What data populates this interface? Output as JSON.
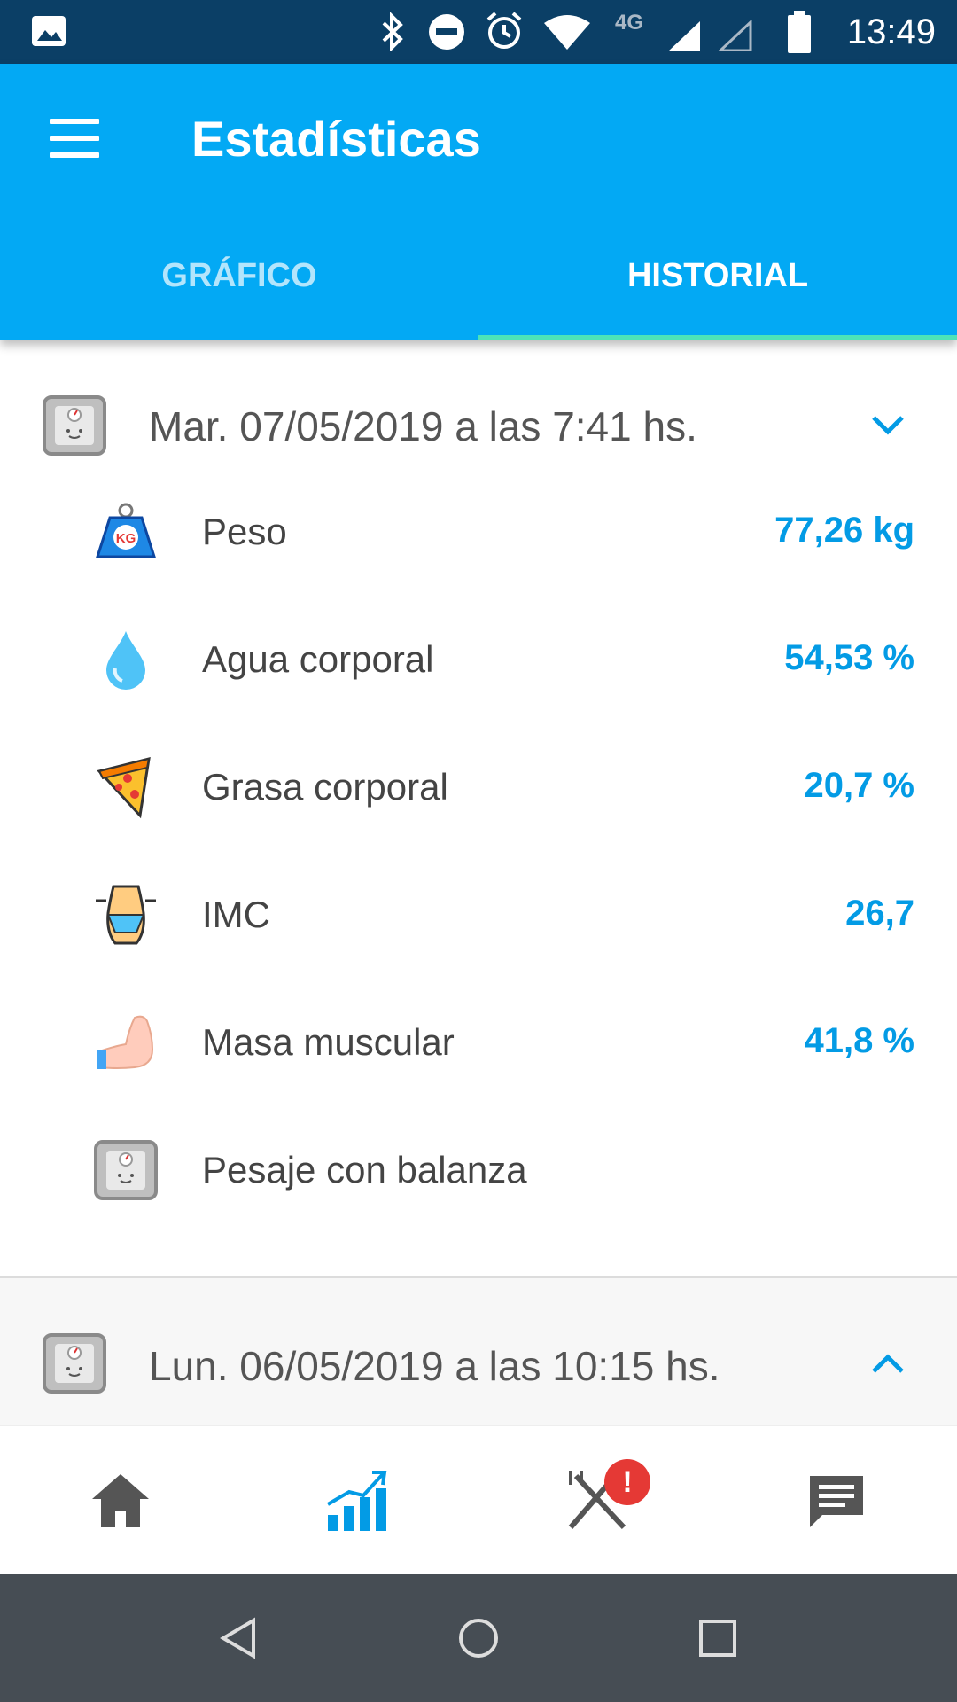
{
  "status_bar": {
    "time": "13:49",
    "network": "4G"
  },
  "header": {
    "title": "Estadísticas",
    "menu_icon": "hamburger-icon"
  },
  "tabs": [
    {
      "label": "GRÁFICO",
      "selected": false
    },
    {
      "label": "HISTORIAL",
      "selected": true
    }
  ],
  "entries": [
    {
      "date": "Mar. 07/05/2019 a las 7:41 hs.",
      "expanded": true,
      "rows": [
        {
          "label": "Peso",
          "value": "77,26 kg",
          "icon": "weight-kg-icon"
        },
        {
          "label": "Agua corporal",
          "value": "54,53 %",
          "icon": "water-drop-icon"
        },
        {
          "label": "Grasa corporal",
          "value": "20,7 %",
          "icon": "pizza-slice-icon"
        },
        {
          "label": "IMC",
          "value": "26,7",
          "icon": "waist-icon"
        },
        {
          "label": "Masa muscular",
          "value": "41,8 %",
          "icon": "flexed-arm-icon"
        },
        {
          "label": "Pesaje con balanza",
          "value": "",
          "icon": "scale-icon"
        }
      ]
    },
    {
      "date": "Lun. 06/05/2019 a las 10:15 hs.",
      "expanded": false
    }
  ],
  "bottom_nav": {
    "items": [
      "home-icon",
      "stats-chart-icon",
      "fork-knife-icon",
      "chat-icon"
    ],
    "active": "stats-chart-icon",
    "badge": "!"
  },
  "colors": {
    "primary": "#03a9f4",
    "status_bar": "#0b3f66",
    "value_text": "#039be5",
    "tab_indicator": "#4ce3b8",
    "badge": "#e53935",
    "nav_bar": "#464d54"
  }
}
